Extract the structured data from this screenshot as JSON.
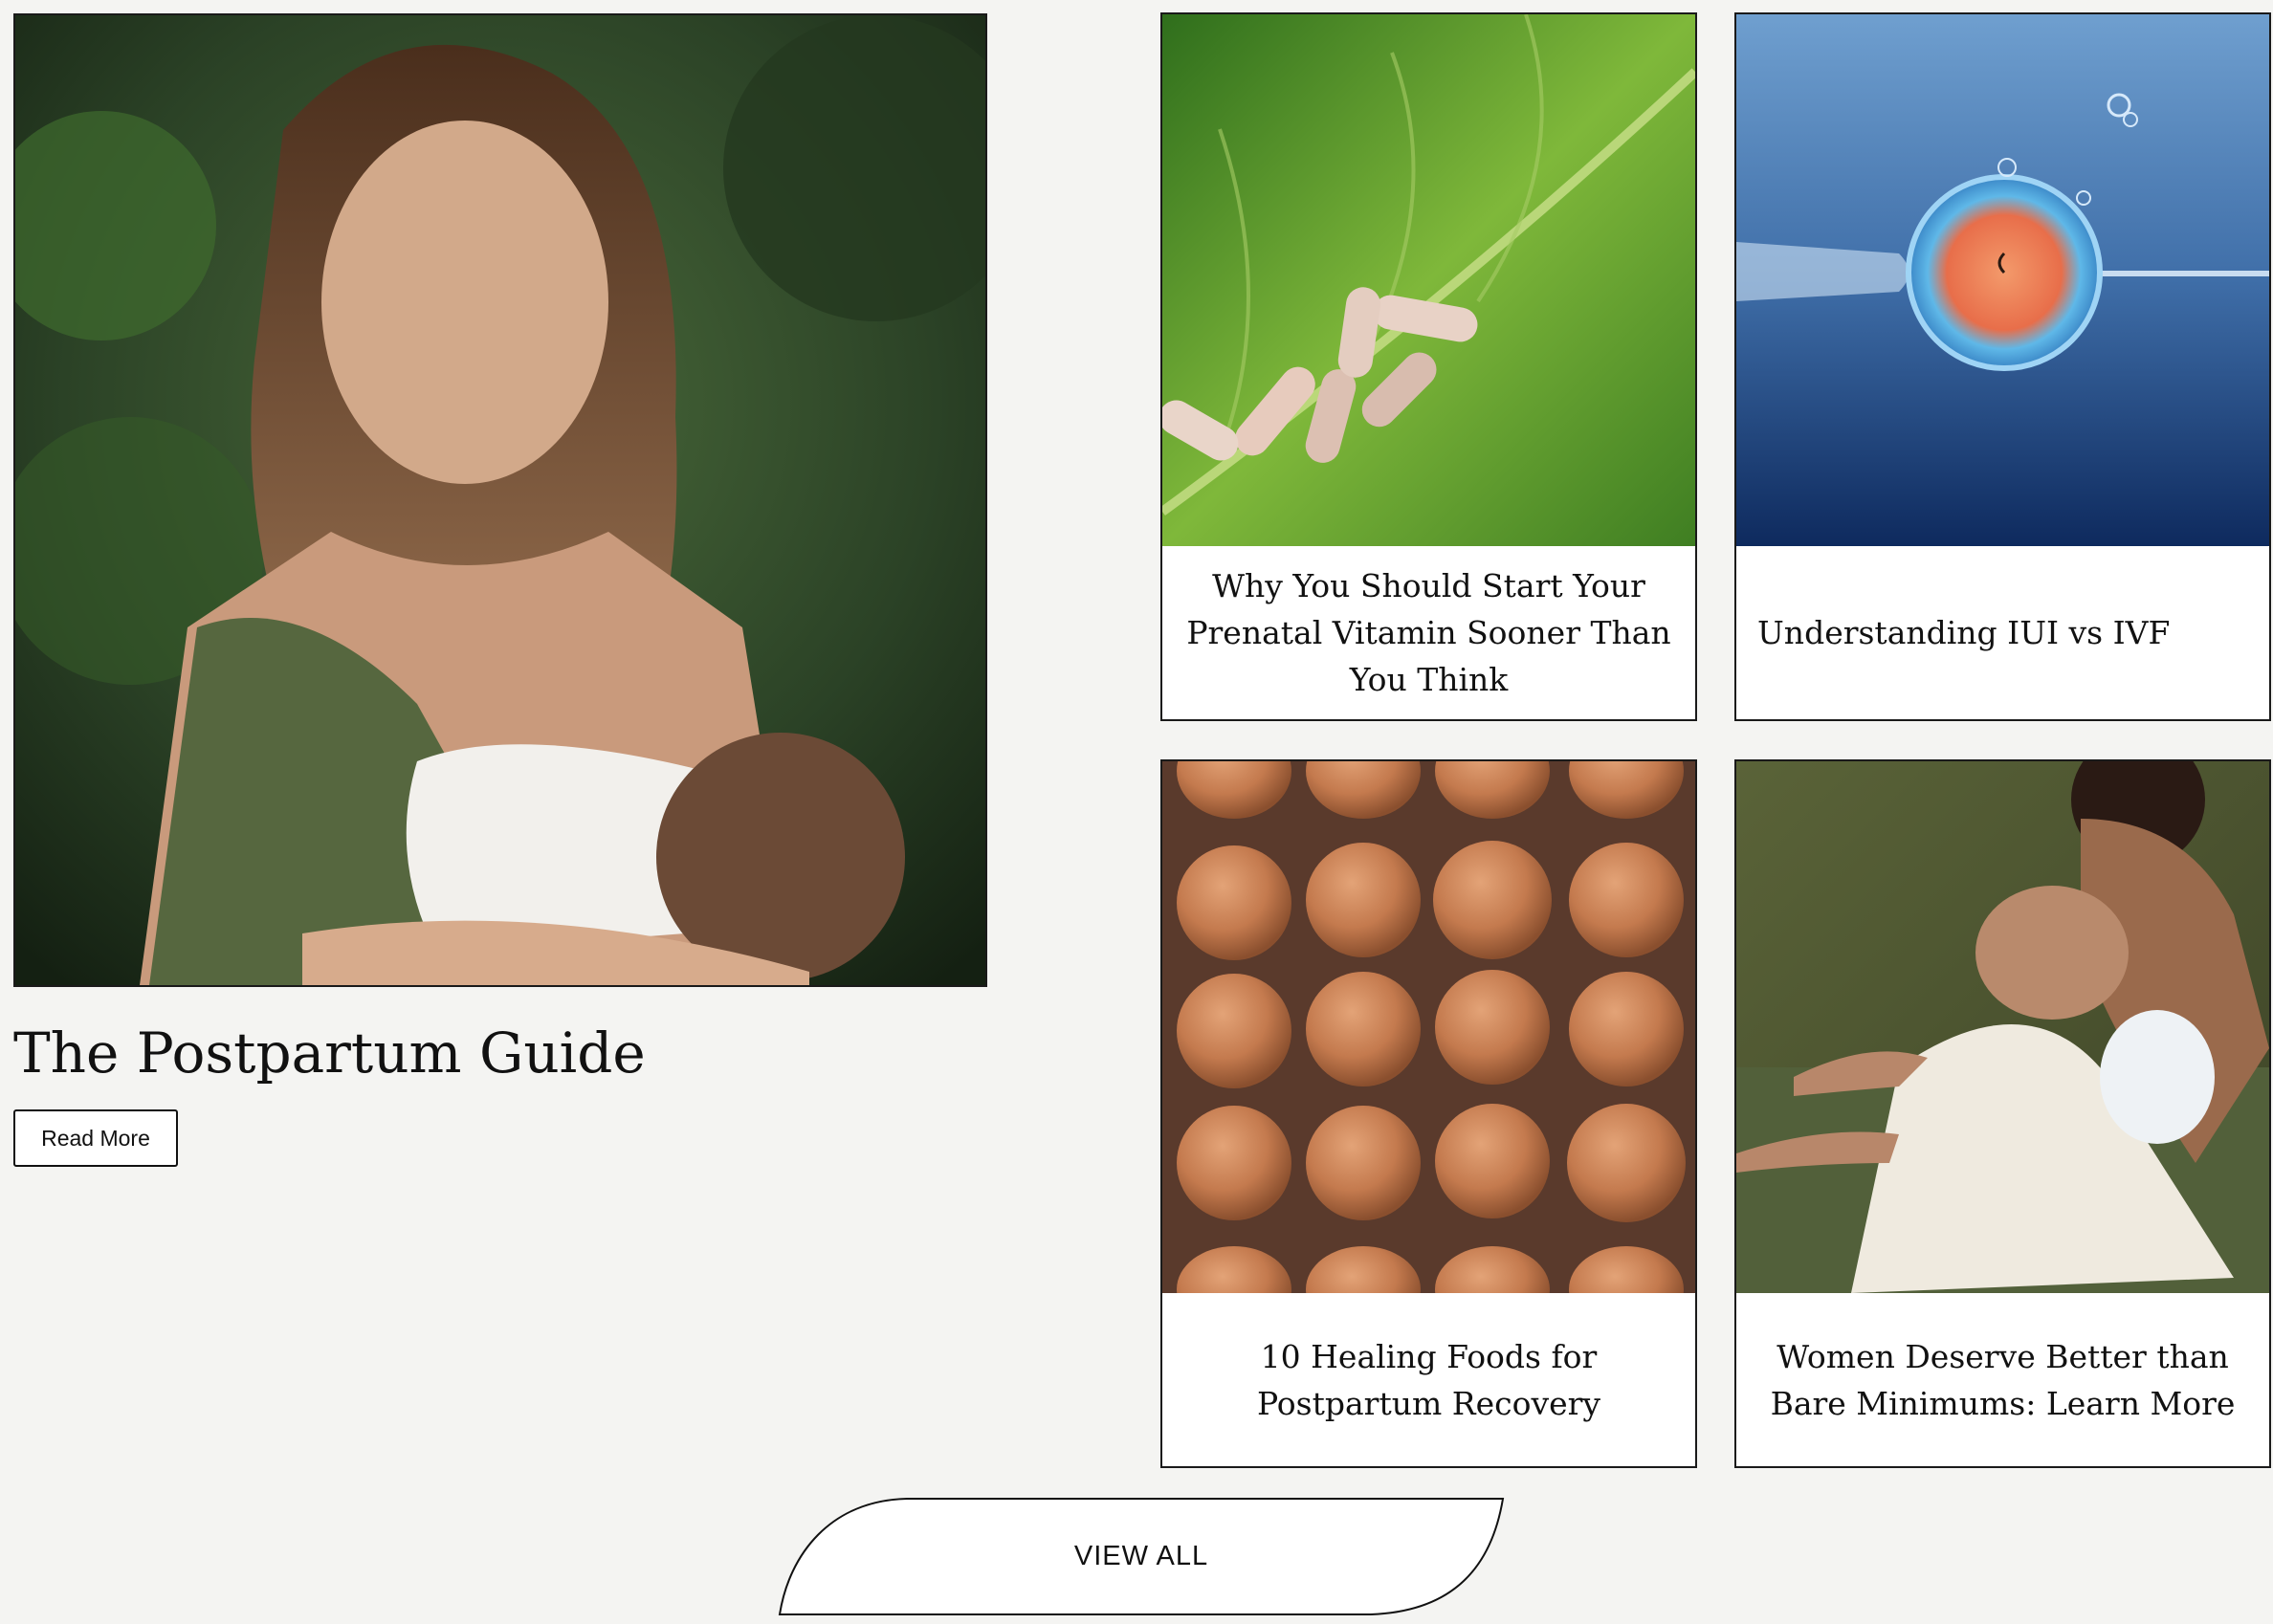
{
  "featured": {
    "title": "The Postpartum Guide",
    "button_label": "Read More",
    "image": "mother-breastfeeding-baby-photo"
  },
  "cards": [
    {
      "title": "Why You Should Start Your Prenatal Vitamin Sooner Than You Think",
      "image": "capsules-on-green-leaf-photo"
    },
    {
      "title": "Understanding IUI vs IVF",
      "image": "egg-cell-fertilization-photo"
    },
    {
      "title": "10 Healing Foods for Postpartum Recovery",
      "image": "eggs-in-carton-photo"
    },
    {
      "title": "Women Deserve Better than Bare Minimums: Learn More",
      "image": "woman-breastfeeding-on-sofa-photo"
    }
  ],
  "view_all": {
    "label": "VIEW ALL"
  },
  "colors": {
    "background": "#f4f4f2",
    "text": "#111111",
    "card_background": "#ffffff",
    "border": "#1a1a1a"
  }
}
